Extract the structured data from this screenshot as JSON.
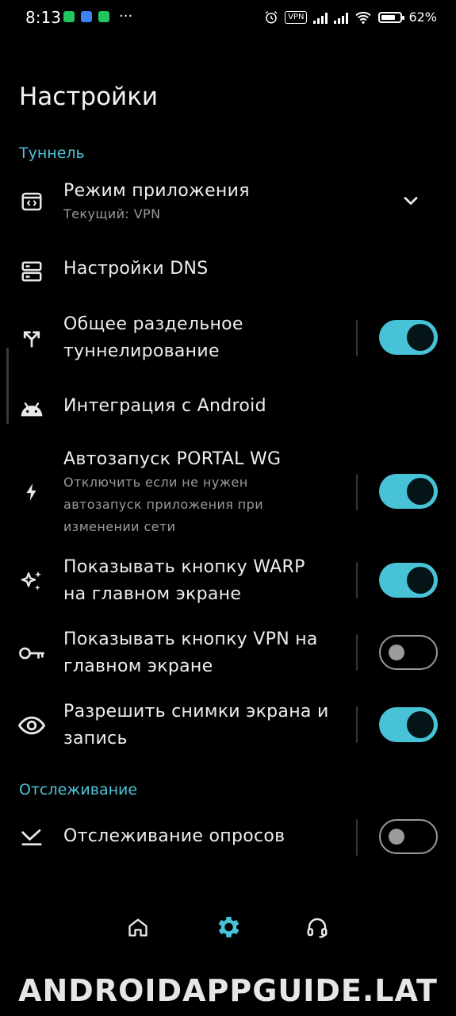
{
  "status_bar": {
    "time": "8:13",
    "vpn_badge": "VPN",
    "battery": "62%"
  },
  "page_title": "Настройки",
  "sections": {
    "tunnel": "Туннель",
    "tracking": "Отслеживание"
  },
  "items": {
    "app_mode": {
      "label": "Режим приложения",
      "subtitle": "Текущий: VPN"
    },
    "dns": {
      "label": "Настройки DNS"
    },
    "split": {
      "label_1": "Общее раздельное",
      "label_2": "туннелирование",
      "enabled": true
    },
    "android": {
      "label": "Интеграция с Android"
    },
    "autostart": {
      "label": "Автозапуск PORTAL WG",
      "sub_1": "Отключить если не нужен",
      "sub_2": "автозапуск приложения при",
      "sub_3": "изменении сети",
      "enabled": true
    },
    "warp": {
      "label_1": "Показывать кнопку WARP",
      "label_2": "на главном экране",
      "enabled": true
    },
    "vpn_btn": {
      "label_1": "Показывать кнопку VPN на",
      "label_2": "главном экране",
      "enabled": false
    },
    "screenshots": {
      "label_1": "Разрешить снимки экрана и",
      "label_2": "запись",
      "enabled": true
    },
    "polls": {
      "label": "Отслеживание опросов",
      "enabled": false
    }
  },
  "bottom_nav": {
    "home_icon": "home-icon",
    "settings_icon": "gear-icon",
    "support_icon": "headset-icon",
    "active": "settings",
    "accent": "#47c2d6"
  },
  "watermark": "ANDROIDAPPGUIDE.LAT"
}
